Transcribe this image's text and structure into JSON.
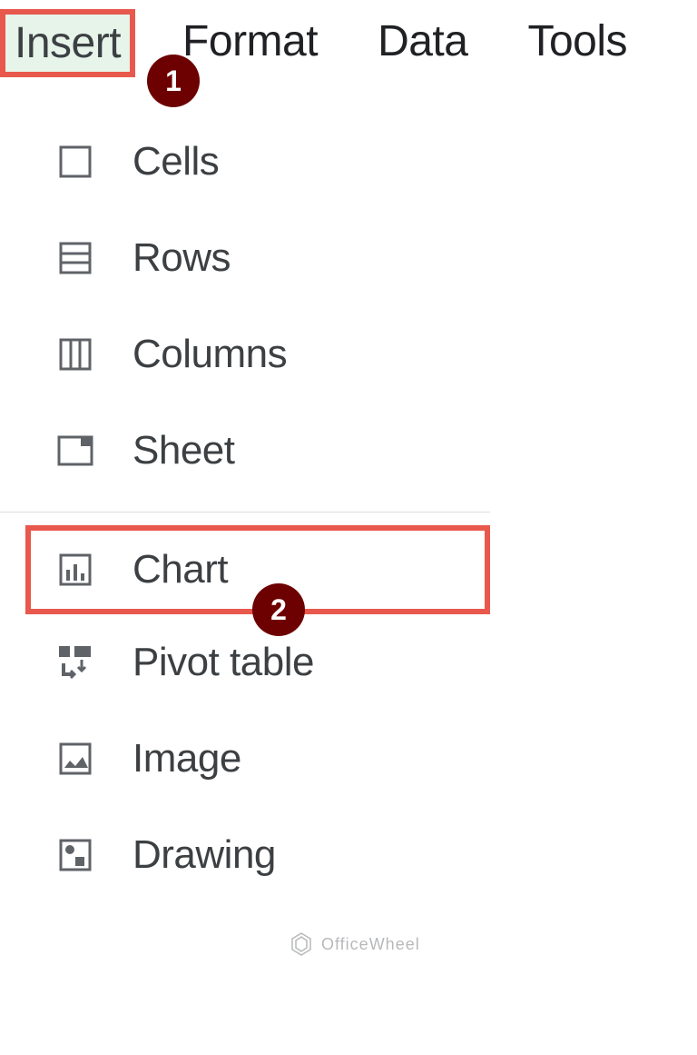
{
  "menubar": {
    "items": [
      {
        "label": "Insert"
      },
      {
        "label": "Format"
      },
      {
        "label": "Data"
      },
      {
        "label": "Tools"
      }
    ]
  },
  "callouts": {
    "badge1": "1",
    "badge2": "2"
  },
  "dropdown": {
    "section1": [
      {
        "label": "Cells",
        "icon": "cells"
      },
      {
        "label": "Rows",
        "icon": "rows"
      },
      {
        "label": "Columns",
        "icon": "columns"
      },
      {
        "label": "Sheet",
        "icon": "sheet"
      }
    ],
    "section2": [
      {
        "label": "Chart",
        "icon": "chart"
      },
      {
        "label": "Pivot table",
        "icon": "pivot"
      },
      {
        "label": "Image",
        "icon": "image"
      },
      {
        "label": "Drawing",
        "icon": "drawing"
      }
    ]
  },
  "watermark": {
    "text": "OfficeWheel"
  }
}
